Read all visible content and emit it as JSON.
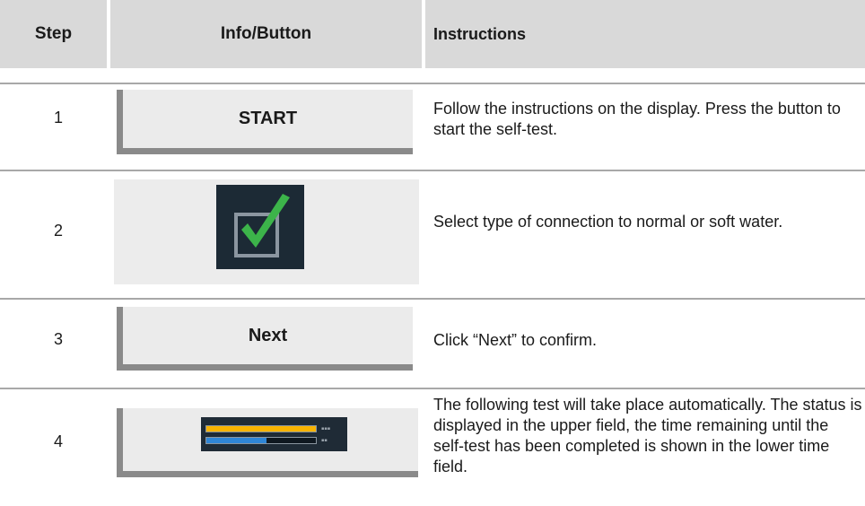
{
  "header": {
    "step": "Step",
    "info": "Info/Button",
    "instructions": "Instructions"
  },
  "rows": [
    {
      "step": "1",
      "button_label": "START",
      "instruction": "Follow the instructions on the display. Press the button to start the self-test."
    },
    {
      "step": "2",
      "icon": "checkbox-checked-icon",
      "instruction": "Select type of connection to normal or soft water."
    },
    {
      "step": "3",
      "button_label": "Next",
      "instruction": "Click “Next” to confirm."
    },
    {
      "step": "4",
      "icon": "progress-status-icon",
      "status_progress": 1.0,
      "time_progress": 0.55,
      "instruction": "The following test will take place automatically. The status is displayed in the upper field, the time remaining until the self-test has been completed is shown in the lower time field."
    }
  ],
  "colors": {
    "header_bg": "#d9d9d9",
    "button_bg": "#ebebeb",
    "button_shadow": "#8a8a8a",
    "divider": "#a8a8a8",
    "tile_bg": "#1c2a35",
    "check_green": "#3cb44a",
    "status_yellow": "#f7b300",
    "time_blue": "#2f86d6"
  }
}
